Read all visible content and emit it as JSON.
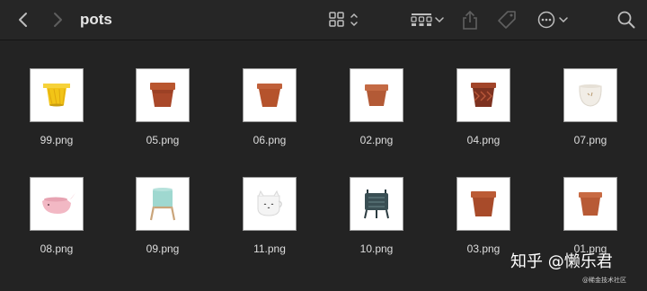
{
  "window": {
    "folder_title": "pots"
  },
  "toolbar": {
    "icons": [
      "back-chevron-icon",
      "forward-chevron-icon",
      "icon-view-icon",
      "group-by-icon",
      "share-icon",
      "tag-icon",
      "more-actions-icon",
      "search-icon"
    ]
  },
  "files": [
    {
      "name": "99.png",
      "pot": "yellow"
    },
    {
      "name": "05.png",
      "pot": "terracotta-rim"
    },
    {
      "name": "06.png",
      "pot": "terracotta"
    },
    {
      "name": "02.png",
      "pot": "terracotta-rim"
    },
    {
      "name": "04.png",
      "pot": "terracotta-carved"
    },
    {
      "name": "07.png",
      "pot": "white-round"
    },
    {
      "name": "08.png",
      "pot": "pink-whale"
    },
    {
      "name": "09.png",
      "pot": "mint-stand"
    },
    {
      "name": "11.png",
      "pot": "white-cat"
    },
    {
      "name": "10.png",
      "pot": "dark-cauldron"
    },
    {
      "name": "03.png",
      "pot": "terracotta-rim"
    },
    {
      "name": "01.png",
      "pot": "terracotta"
    }
  ],
  "watermark": {
    "main": "知乎 @懒乐君",
    "small": "@稀金技术社区"
  },
  "colors": {
    "background": "#232323",
    "toolbar": "#262626",
    "text": "#dedede",
    "terracotta": "#b5532c"
  }
}
